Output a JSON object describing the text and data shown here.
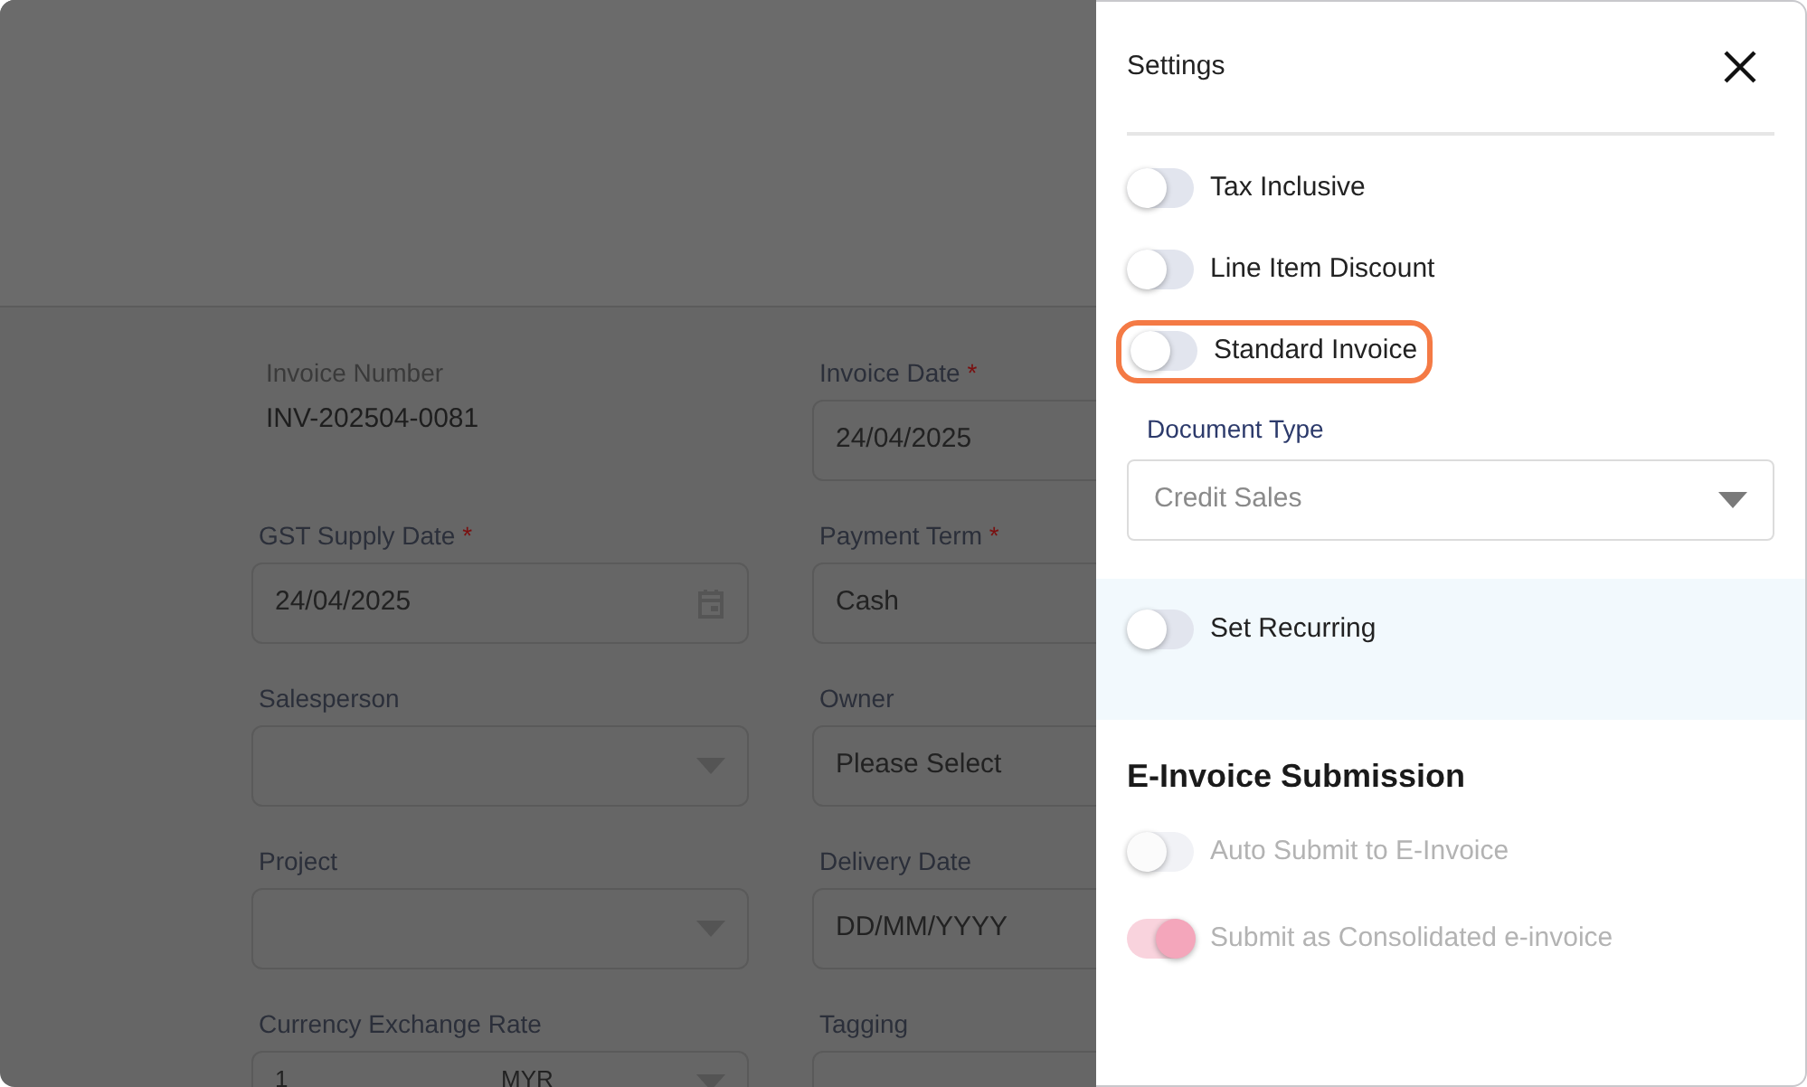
{
  "form": {
    "fields": [
      {
        "kind": "text",
        "label": "Invoice Number",
        "value": "INV-202504-0081"
      },
      {
        "kind": "input",
        "label": "Invoice Date",
        "required_mark": "*",
        "value": "24/04/2025"
      },
      {
        "kind": "date",
        "label": "GST Supply Date",
        "required_mark": "*",
        "value": "24/04/2025"
      },
      {
        "kind": "input",
        "label": "Payment Term",
        "required_mark": "*",
        "value": "Cash"
      },
      {
        "kind": "select",
        "label": "Salesperson"
      },
      {
        "kind": "input",
        "label": "Owner",
        "placeholder": "Please Select"
      },
      {
        "kind": "select",
        "label": "Project"
      },
      {
        "kind": "input",
        "label": "Delivery Date",
        "placeholder": "DD/MM/YYYY"
      },
      {
        "kind": "currency",
        "label": "Currency Exchange Rate",
        "value": "1",
        "unit": "MYR"
      },
      {
        "kind": "input",
        "label": "Tagging"
      }
    ]
  },
  "settings": {
    "title": "Settings",
    "toggles": [
      {
        "label": "Tax Inclusive",
        "on": false,
        "highlighted": false
      },
      {
        "label": "Line Item Discount",
        "on": false,
        "highlighted": false
      },
      {
        "label": "Standard Invoice",
        "on": false,
        "highlighted": true
      }
    ],
    "document_type": {
      "label": "Document Type",
      "value": "Credit Sales"
    },
    "recurring": {
      "label": "Set Recurring",
      "on": false
    },
    "einvoice": {
      "title": "E-Invoice Submission",
      "toggles": [
        {
          "label": "Auto Submit to E-Invoice",
          "on": false,
          "disabled": true
        },
        {
          "label": "Submit as Consolidated e-invoice",
          "on": true,
          "disabled": true
        }
      ]
    }
  }
}
